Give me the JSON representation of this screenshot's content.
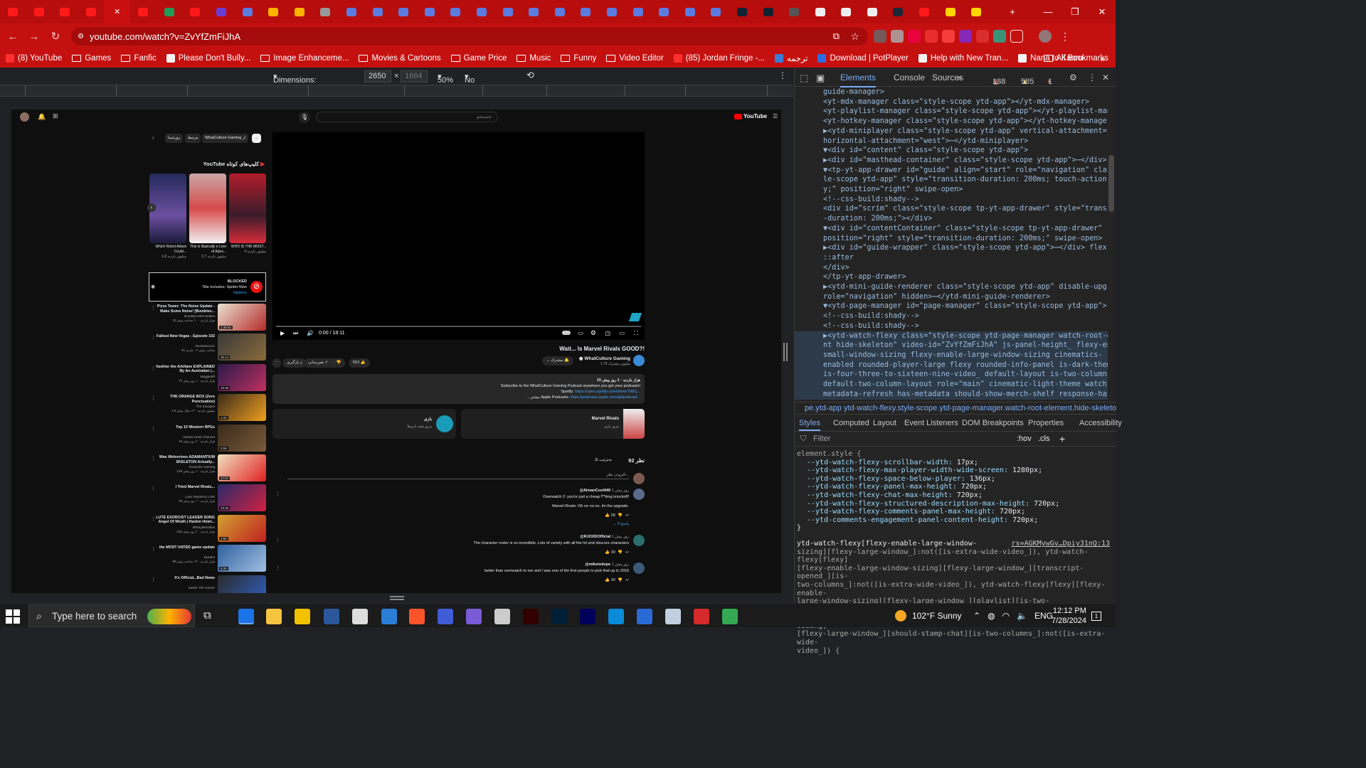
{
  "browser": {
    "url": "youtube.com/watch?v=ZvYfZmFiJhA",
    "tab_count_visible": 38,
    "accent": "#c51010"
  },
  "bookmarks": [
    {
      "label": "(8) YouTube",
      "icon": "youtube-icon"
    },
    {
      "label": "Games",
      "icon": "folder-icon"
    },
    {
      "label": "Fanfic",
      "icon": "folder-icon"
    },
    {
      "label": "Please Don't Bully...",
      "icon": "page-icon"
    },
    {
      "label": "Image Enhanceme...",
      "icon": "folder-icon"
    },
    {
      "label": "Movies & Cartoons",
      "icon": "folder-icon"
    },
    {
      "label": "Game Price",
      "icon": "folder-icon"
    },
    {
      "label": "Music",
      "icon": "folder-icon"
    },
    {
      "label": "Funny",
      "icon": "folder-icon"
    },
    {
      "label": "Video Editor",
      "icon": "folder-icon"
    },
    {
      "label": "(85) Jordan Fringe -...",
      "icon": "youtube-icon"
    },
    {
      "label": "ترجمه",
      "icon": "translate-icon"
    },
    {
      "label": "Download | PotPlayer",
      "icon": "potplayer-icon"
    },
    {
      "label": "Help with New Tran...",
      "icon": "page-icon"
    },
    {
      "label": "Nana to Kaoru",
      "icon": "page-icon"
    }
  ],
  "all_bookmarks": "All Bookmarks",
  "device_toolbar": {
    "dimensions": "Dimensions: Responsive",
    "width": "2650",
    "height_placeholder": "1664",
    "zoom": "50%",
    "throttling": "No throttling"
  },
  "youtube": {
    "search_placeholder": "جستجو",
    "logo_text": "YouTube",
    "chips": [
      "...",
      "WhatCulture Gaming از",
      "مرتبط",
      "روزشما"
    ],
    "shorts_header": "YouTube کلیپ‌های کوتاه",
    "shorts": [
      {
        "title": "Which Robot Attack Could...",
        "views": "1.8 میلیون بازدید"
      },
      {
        "title": "This is Basically e Lore of Apex...",
        "views": "3.7 میلیون بازدید"
      },
      {
        "title": "WHO IS THE MOST...",
        "views": "4 میلیون بازدید"
      }
    ],
    "blocked": {
      "title": "BLOCKED",
      "reason": "Title includes: Spider-Man",
      "options": "Options"
    },
    "recommendations": [
      {
        "title": "Pizza Tower: The Noise Update - Make Some Noise! [Bumbles...",
        "channel": "Bumbles McFumbles",
        "meta": "23 هزار بازدید · ۱۰ ساعت پیش",
        "duration": "1:35:52"
      },
      {
        "title": "Fallout New Vegas - Episode 102",
        "channel": "YouNotesLive",
        "meta": "ساعت پیش ۴ · بازدید ۹۸",
        "duration": "26:14"
      },
      {
        "title": "Vashtor the Arkifane EXPLAINED By An Australian |...",
        "channel": "Maggiekill",
        "meta": "77 هزار بازدید · ۱ روز پیش",
        "duration": "10:46"
      },
      {
        "title": "THE ORANGE BOX (Zero Punctuation)",
        "channel": "The Escapist",
        "meta": "1.8 میلیون بازدید · ۱۳ سال پیش",
        "duration": "4:23"
      },
      {
        "title": "Top 10 Western RPGs",
        "channel": "Variant Geek Channel",
        "meta": "13 هزار بازدید · ۲ روز پیش",
        "duration": "9:59"
      },
      {
        "title": "Was Wolverines ADAMANTIUM SKELETON Actually...",
        "channel": "Roanoke Gaming",
        "meta": "128 هزار بازدید · ۱ روز پیش",
        "duration": "17:07"
      },
      {
        "title": "I Tried Marvel Rivals...",
        "channel": "Luke Stephens LIVE",
        "meta": "78 هزار بازدید · ۱ روز پیش",
        "duration": "23:25"
      },
      {
        "title": "LUTE EXORCIST LEADER SONG Angel Of Wrath | Hazbin Hotel...",
        "channel": "MiRayMelodies",
        "meta": "222 هزار بازدید · ۲ روز پیش",
        "duration": "2:50"
      },
      {
        "title": "the MOST HATED game update",
        "channel": "bpatino",
        "meta": "88 هزار بازدید · ۱۴ ساعت پیش",
        "duration": "9:20"
      },
      {
        "title": "It's Official...Bad News",
        "channel": "Sadio! The Gamer",
        "meta": "",
        "duration": ""
      }
    ],
    "player": {
      "time": "0:00 / 18:11"
    },
    "video_title": "Wait... Is Marvel Rivals GOOD?!",
    "channel_name": "WhatCulture Gaming",
    "subscribers": "1.72 میلیون مشترک",
    "subscribe_label": "مشترک",
    "likes": "553",
    "dislike_count": "۱۰",
    "share_label": "هم‌رسانی",
    "download_label": "بارگیری",
    "description_meta": "15 هزار بازدید · 1 روز پیش",
    "description_line1": "Subscribe to the WhatCulture Gaming Podcast anywhere you get your podcasts!",
    "description_spotify_label": "Spotify:",
    "description_spotify": "https://open.spotify.com/show/7Wi1j...",
    "description_apple_label": "Apple Podcasts:",
    "description_apple": "https://podcasts.apple.com/gb/podcast...",
    "description_more": "...بیشتر",
    "card_game": {
      "title": "Marvel Rivals",
      "sub": "مرور بازی"
    },
    "card_games": {
      "title": "بازی",
      "sub": "مرور همه بازی‌ها"
    },
    "comments_count": "92 نظر",
    "sort_label": "به‌ترتیب",
    "add_comment": "افزودن نظر...",
    "comments": [
      {
        "author": "@AlmanCool440",
        "time": "1 روز پیش",
        "text": "Overwatch 2: you're just a cheap f**king knockoff!",
        "text2": "Marvel Rivals: Oh no no no, Im the upgrade.",
        "likes": "58",
        "replies": "6 پاسخ"
      },
      {
        "author": "@RJOXDOfficial",
        "time": "1 روز پیش",
        "text": "The character roster is so incredible. Lots of variety with all the hit and obscure characters",
        "likes": "30"
      },
      {
        "author": "@mikelodope",
        "time": "1 روز پیش",
        "text": "better than overwatch to me and I was one of the first people to pick that up in 2016",
        "likes": "30"
      }
    ]
  },
  "devtools": {
    "tabs": [
      "Elements",
      "Console",
      "Sources"
    ],
    "errors": "138",
    "warnings": "585",
    "issues": "1",
    "dom_lines": [
      "guide-manager>",
      "<yt-mdx-manager class=\"style-scope ytd-app\"></yt-mdx-manager>",
      "<yt-playlist-manager class=\"style-scope ytd-app\"></yt-playlist-manager>",
      "<yt-hotkey-manager class=\"style-scope ytd-app\"></yt-hotkey-manager>",
      "▶<ytd-miniplayer class=\"style-scope ytd-app\" vertical-attachment=\"south\"",
      "horizontal-attachment=\"west\">⋯</ytd-miniplayer>",
      "▼<div id=\"content\" class=\"style-scope ytd-app\">",
      "  ▶<div id=\"masthead-container\" class=\"style-scope ytd-app\">⋯</div>",
      "  ▼<tp-yt-app-drawer id=\"guide\" align=\"start\" role=\"navigation\" class=\"sty",
      "  le-scope ytd-app\" style=\"transition-duration: 200ms; touch-action: pan-",
      "  y;\" position=\"right\" swipe-open>",
      "    <!--css-build:shady-->",
      "    <div id=\"scrim\" class=\"style-scope tp-yt-app-drawer\" style=\"transition",
      "    -duration: 200ms;\"></div>",
      "    ▼<div id=\"contentContainer\" class=\"style-scope tp-yt-app-drawer\"",
      "    position=\"right\" style=\"transition-duration: 200ms;\" swipe-open>",
      "      ▶<div id=\"guide-wrapper\" class=\"style-scope ytd-app\">⋯</div> flex",
      "       ::after",
      "    </div>",
      "  </tp-yt-app-drawer>",
      "  ▶<ytd-mini-guide-renderer class=\"style-scope ytd-app\" disable-upgrade",
      "  role=\"navigation\" hidden>⋯</ytd-mini-guide-renderer>",
      "  ▼<ytd-page-manager id=\"page-manager\" class=\"style-scope ytd-app\"> flex",
      "    <!--css-build:shady-->",
      "    <!--css-build:shady-->",
      "    ▶<ytd-watch-flexy class=\"style-scope ytd-page-manager watch-root-eleme",
      "    nt hide-skeleton\" video-id=\"ZvYfZmFiJhA\" js-panel-height_ flexy-enable-",
      "    small-window-sizing flexy-enable-large-window-sizing cinematics-",
      "    enabled rounded-player-large flexy rounded-info-panel is-dark-theme",
      "    is-four-three-to-sixteen-nine-video_ default-layout is-two-columns_",
      "    default-two-column-layout role=\"main\" cinematic-light-theme watch-",
      "    metadata-refresh has-metadata should-show-merch-shelf response-has-"
    ],
    "breadcrumb": "pe.ytd-app   ytd-watch-flexy.style-scope.ytd-page-manager.watch-root-element.hide-skeleton",
    "styles_tabs": [
      "Styles",
      "Computed",
      "Layout",
      "Event Listeners",
      "DOM Breakpoints",
      "Properties",
      "Accessibility"
    ],
    "filter_placeholder": "Filter",
    "hov": ":hov",
    "cls": ".cls",
    "element_style": "element.style {",
    "style_props": [
      [
        "--ytd-watch-flexy-scrollbar-width",
        "17px;"
      ],
      [
        "--ytd-watch-flexy-max-player-width-wide-screen",
        "1280px;"
      ],
      [
        "--ytd-watch-flexy-space-below-player",
        "136px;"
      ],
      [
        "--ytd-watch-flexy-panel-max-height",
        "720px;"
      ],
      [
        "--ytd-watch-flexy-chat-max-height",
        "720px;"
      ],
      [
        "--ytd-watch-flexy-structured-description-max-height",
        "720px;"
      ],
      [
        "--ytd-watch-flexy-comments-panel-max-height",
        "720px;"
      ],
      [
        "--ytd-comments-engagement-panel-content-height",
        "720px;"
      ]
    ],
    "close_brace": "}",
    "rule_selector": "ytd-watch-flexy[flexy-enable-large-window-",
    "rule_source": "rs=AGKMywGv…Dpiy31nQ:13",
    "rule_lines": [
      "sizing][flexy-large-window_]:not([is-extra-wide-video_]), ytd-watch-flexy[flexy]",
      "[flexy-enable-large-window-sizing][flexy-large-window_][transcript-opened_][is-",
      "two-columns_]:not([is-extra-wide-video_]), ytd-watch-flexy[flexy][flexy-enable-",
      "large-window-sizing][flexy-large-window_][playlist][is-two-columns_]:not([is-",
      "extra-wide-video_]), ytd-watch-flexy[flexy][flexy-enable-large-window-sizing]",
      "[flexy-large-window_][should-stamp-chat][is-two-columns_]:not([is-extra-wide-",
      "video_]) {"
    ]
  },
  "taskbar": {
    "search_placeholder": "Type here to search",
    "weather": "102°F  Sunny",
    "lang": "ENG",
    "time": "12:12 PM",
    "date": "7/28/2024",
    "notif_count": "1"
  }
}
